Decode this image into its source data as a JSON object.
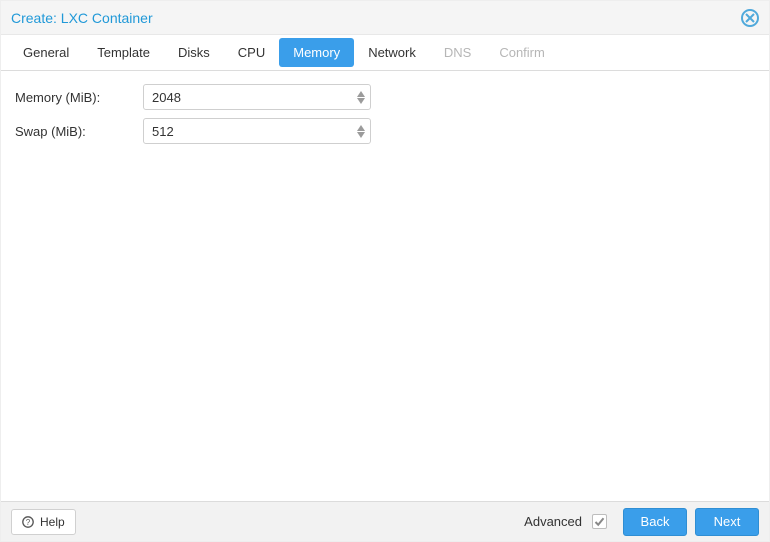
{
  "title": "Create: LXC Container",
  "tabs": [
    {
      "label": "General",
      "state": "normal"
    },
    {
      "label": "Template",
      "state": "normal"
    },
    {
      "label": "Disks",
      "state": "normal"
    },
    {
      "label": "CPU",
      "state": "normal"
    },
    {
      "label": "Memory",
      "state": "active"
    },
    {
      "label": "Network",
      "state": "normal"
    },
    {
      "label": "DNS",
      "state": "disabled"
    },
    {
      "label": "Confirm",
      "state": "disabled"
    }
  ],
  "form": {
    "memory": {
      "label": "Memory (MiB):",
      "value": "2048"
    },
    "swap": {
      "label": "Swap (MiB):",
      "value": "512"
    }
  },
  "footer": {
    "help": "Help",
    "advanced_label": "Advanced",
    "advanced_checked": true,
    "back": "Back",
    "next": "Next"
  }
}
